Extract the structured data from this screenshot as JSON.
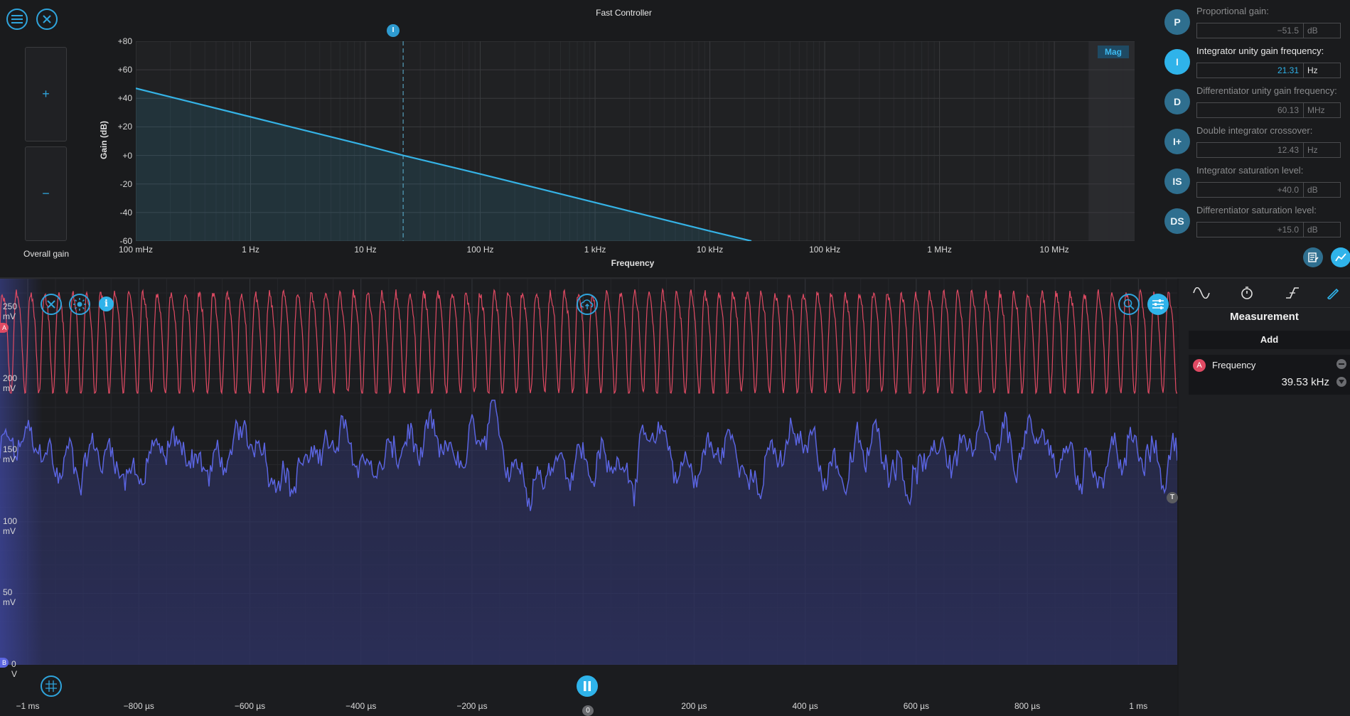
{
  "controller": {
    "title": "Fast Controller",
    "overall_gain_label": "Overall gain",
    "plus": "+",
    "minus": "−",
    "mag_tag": "Mag",
    "marker_label": "I",
    "ylabel": "Gain (dB)",
    "xlabel": "Frequency",
    "y_ticks": [
      "+80",
      "+60",
      "+40",
      "+20",
      "+0",
      "-20",
      "-40",
      "-60"
    ],
    "x_ticks": [
      "100 mHz",
      "1 Hz",
      "10 Hz",
      "100 Hz",
      "1 kHz",
      "10 kHz",
      "100 kHz",
      "1 MHz",
      "10 MHz"
    ]
  },
  "params": [
    {
      "badge": "P",
      "label": "Proportional gain:",
      "value": "−51.5",
      "unit": "dB"
    },
    {
      "badge": "I",
      "label": "Integrator unity gain frequency:",
      "value": "21.31",
      "unit": "Hz"
    },
    {
      "badge": "D",
      "label": "Differentiator unity gain frequency:",
      "value": "60.13",
      "unit": "MHz"
    },
    {
      "badge": "I+",
      "label": "Double integrator crossover:",
      "value": "12.43",
      "unit": "Hz"
    },
    {
      "badge": "IS",
      "label": "Integrator saturation level:",
      "value": "+40.0",
      "unit": "dB"
    },
    {
      "badge": "DS",
      "label": "Differentiator saturation level:",
      "value": "+15.0",
      "unit": "dB"
    }
  ],
  "scope": {
    "y_ticks": [
      "250 mV",
      "200 mV",
      "150 mV",
      "100 mV",
      "50 mV",
      "0 V"
    ],
    "x_ticks": [
      "−1 ms",
      "−800 µs",
      "−600 µs",
      "−400 µs",
      "−200 µs",
      "200 µs",
      "400 µs",
      "600 µs",
      "800 µs",
      "1 ms"
    ],
    "channel_a_label": "A",
    "channel_b_label": "B",
    "trigger_label": "T",
    "zero_label": "0"
  },
  "measurement": {
    "title": "Measurement",
    "add_label": "Add",
    "item": {
      "channel": "A",
      "name": "Frequency",
      "value": "39.53 kHz"
    }
  },
  "colors": {
    "accent": "#2fa4dc",
    "channel_a": "#e04a63",
    "channel_b": "#5a64e0",
    "bode_line": "#35b3e6"
  },
  "chart_data": [
    {
      "type": "line",
      "title": "Fast Controller",
      "xlabel": "Frequency",
      "ylabel": "Gain (dB)",
      "x_scale": "log",
      "xlim": [
        0.1,
        50000000
      ],
      "ylim": [
        -60,
        80
      ],
      "series": [
        {
          "x": [
            0.1,
            1,
            10,
            21.31,
            100,
            1000,
            10000,
            23000
          ],
          "y": [
            47,
            27,
            7,
            0,
            -13,
            -33,
            -53,
            -60
          ]
        }
      ]
    },
    {
      "type": "line",
      "xlim": [
        -1.05,
        1.07
      ],
      "xunit": "ms",
      "ylim": [
        0,
        270
      ],
      "yunit": "mV",
      "series": [
        {
          "name": "A",
          "mean_mV": 230,
          "min_mV": 190,
          "max_mV": 270,
          "frequency_kHz": 39.53
        },
        {
          "name": "B",
          "mean_mV": 145,
          "min_mV": 85,
          "max_mV": 185
        }
      ]
    }
  ]
}
